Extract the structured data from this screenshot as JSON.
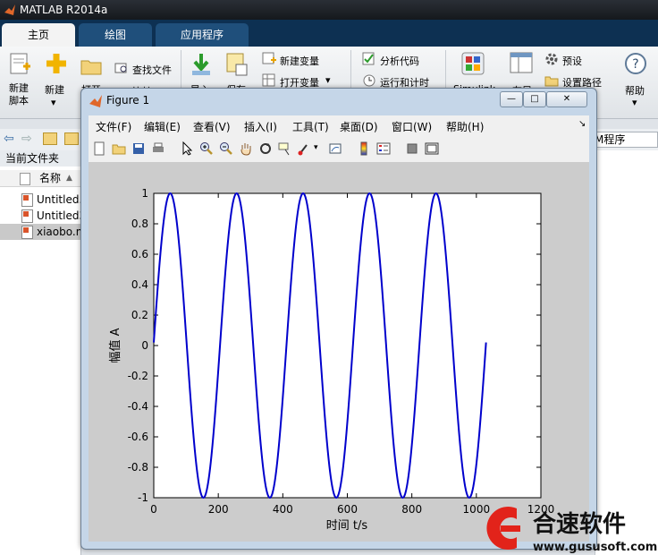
{
  "app": {
    "title": "MATLAB R2014a"
  },
  "ribbon_tabs": [
    "主页",
    "绘图",
    "应用程序"
  ],
  "ribbon": {
    "new_script": "新建\n脚本",
    "new": "新建",
    "open": "打开",
    "find_files": "查找文件",
    "compare": "比较",
    "import": "导入",
    "save": "保存",
    "new_variable": "新建变量",
    "open_variable": "打开变量",
    "analyze_code": "分析代码",
    "run_and_time": "运行和计时",
    "simulink": "Simulink",
    "layout": "布局",
    "preferences": "预设",
    "set_path": "设置路径",
    "help": "帮助"
  },
  "file_panel": {
    "header": "当前文件夹",
    "column_name": "名称",
    "files": [
      "Untitled.",
      "Untitled3",
      "xiaobo.m"
    ]
  },
  "right_panel": {
    "path_text": "M程序"
  },
  "figure": {
    "title": "Figure 1",
    "menus": [
      "文件(F)",
      "编辑(E)",
      "查看(V)",
      "插入(I)",
      "工具(T)",
      "桌面(D)",
      "窗口(W)",
      "帮助(H)"
    ],
    "window_buttons": {
      "min": "—",
      "max": "□",
      "close": "✕"
    },
    "tool_icons": [
      "new-figure-icon",
      "open-icon",
      "save-icon",
      "print-icon",
      "pointer-icon",
      "zoom-in-icon",
      "zoom-out-icon",
      "pan-hand-icon",
      "rotate-icon",
      "data-cursor-icon",
      "brush-icon",
      "link-icon",
      "colorbar-icon",
      "legend-icon",
      "hide-tools-icon",
      "dock-icon"
    ]
  },
  "chart_data": {
    "type": "line",
    "xlabel": "时间 t/s",
    "ylabel": "幅值 A",
    "xlim": [
      0,
      1200
    ],
    "ylim": [
      -1,
      1
    ],
    "xticks": [
      0,
      200,
      400,
      600,
      800,
      1000,
      1200
    ],
    "yticks": [
      -1,
      -0.8,
      -0.6,
      -0.4,
      -0.2,
      0,
      0.2,
      0.4,
      0.6,
      0.8,
      1
    ],
    "series": [
      {
        "color": "#0000cc",
        "function": "sin",
        "amplitude": 1,
        "period": 206,
        "phase_offset": 0.02,
        "x_range": [
          0,
          1030
        ]
      }
    ]
  },
  "watermark": {
    "brand": "合速软件",
    "url": "www.gususoft.com"
  },
  "colors": {
    "ribbon_tab_bg": "#0d3052",
    "plot_line": "#0000cc",
    "figure_bg": "#cccccc"
  }
}
